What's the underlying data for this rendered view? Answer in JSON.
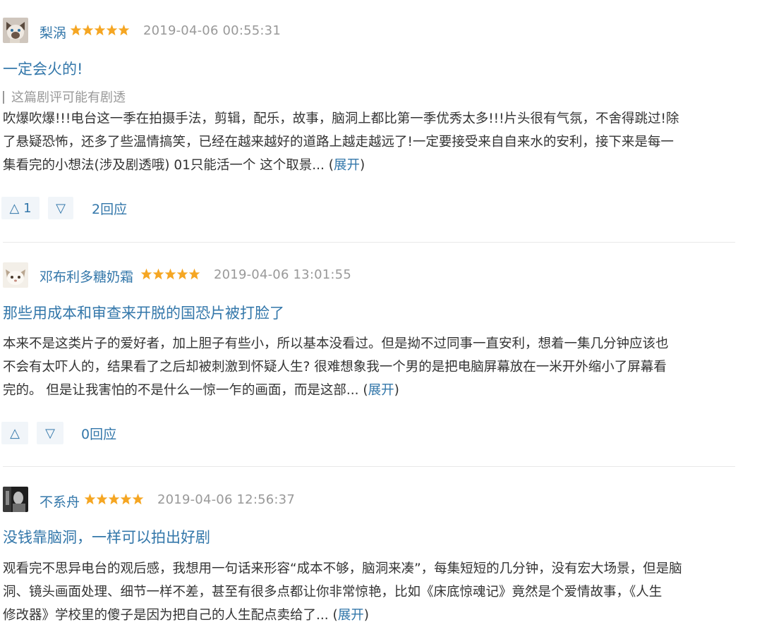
{
  "reviews": [
    {
      "author": "梨涡",
      "rating_stars": 5,
      "time": "2019-04-06 00:55:31",
      "title": "一定会火的!",
      "spoiler_notice": "这篇剧评可能有剧透",
      "body_lines": [
        "吹爆吹爆!!!电台这一季在拍摄手法，剪辑，配乐，故事，脑洞上都比第一季优秀太多!!!片头很有气氛，不舍得跳过!除",
        "了悬疑恐怖，还多了些温情搞笑，已经在越来越好的道路上越走越远了!一定要接受来自自来水的安利，接下来是每一",
        "集看完的小想法(涉及剧透哦) 01只能活一个 这个取景... "
      ],
      "expand_label": "展开",
      "up_label": "△",
      "up_count": "1",
      "down_label": "▽",
      "replies": "2回应"
    },
    {
      "author": "邓布利多糖奶霜",
      "rating_stars": 5,
      "time": "2019-04-06 13:01:55",
      "title": "那些用成本和审查来开脱的国恐片被打脸了",
      "body_lines": [
        "本来不是这类片子的爱好者，加上胆子有些小，所以基本没看过。但是拗不过同事一直安利，想着一集几分钟应该也",
        "不会有太吓人的，结果看了之后却被刺激到怀疑人生? 很难想象我一个男的是把电脑屏幕放在一米开外缩小了屏幕看",
        "完的。 但是让我害怕的不是什么一惊一乍的画面，而是这部... "
      ],
      "expand_label": "展开",
      "up_label": "△",
      "up_count": "",
      "down_label": "▽",
      "replies": "0回应"
    },
    {
      "author": "不系舟",
      "rating_stars": 5,
      "time": "2019-04-06 12:56:37",
      "title": "没钱靠脑洞，一样可以拍出好剧",
      "body_lines": [
        "观看完不思异电台的观后感，我想用一句话来形容“成本不够，脑洞来凑”，每集短短的几分钟，没有宏大场景，但是脑",
        "洞、镜头画面处理、细节一样不差，甚至有很多点都让你非常惊艳，比如《床底惊魂记》竟然是个爱情故事，《人生",
        "修改器》学校里的傻子是因为把自己的人生配点卖给了... "
      ],
      "expand_label": "展开"
    }
  ],
  "colors": {
    "link": "#3377aa",
    "star": "#f5a623",
    "meta": "#999999",
    "button_bg": "#f1f5f9"
  }
}
